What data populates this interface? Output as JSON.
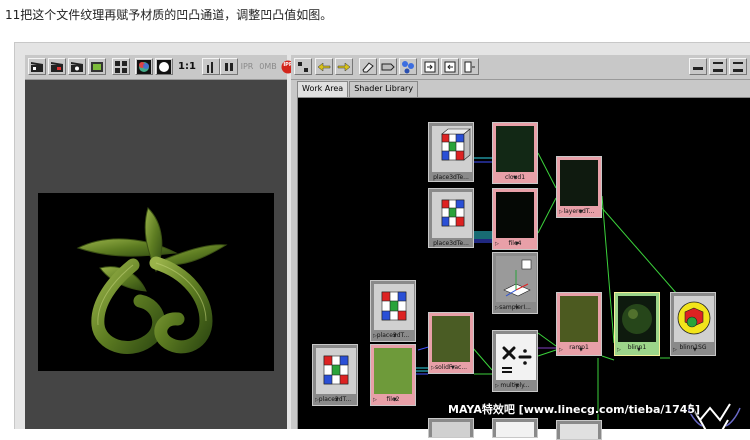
{
  "caption": "11把这个文件纹理再赋予材质的凹凸通道，调整凹凸值如图。",
  "render_view": {
    "toolbar": {
      "ratio_label": "1:1",
      "ipr_label": "IPR",
      "dim_labels": [
        "IPR",
        "0MB"
      ]
    }
  },
  "hypershade": {
    "tabs": [
      "Work Area",
      "Shader Library"
    ],
    "nodes": {
      "place3d_1": "place3dTe...",
      "cloud1": "cloud1",
      "layered": "layeredT...",
      "place3d_2": "place3dTe...",
      "file4": "file4",
      "sampler": "samplerI...",
      "place2d_1": "place2dT...",
      "solid": "solidFrac...",
      "ramp": "ramp1",
      "blinn": "blinn1",
      "blinnsg": "blinn1SG",
      "place2d_2": "place2dT...",
      "file2": "file2",
      "multiply": "multiply..."
    }
  },
  "watermark": "MAYA特效吧 [www.linecg.com/tieba/1745]",
  "colors": {
    "panel": "#c8c8c8",
    "work_area": "#000000",
    "node_pink": "#e8a0a8",
    "node_green": "#9cd58a",
    "connection_green": "#3bd13b",
    "connection_cyan": "#31d6e6",
    "connection_blue": "#4050ff"
  }
}
